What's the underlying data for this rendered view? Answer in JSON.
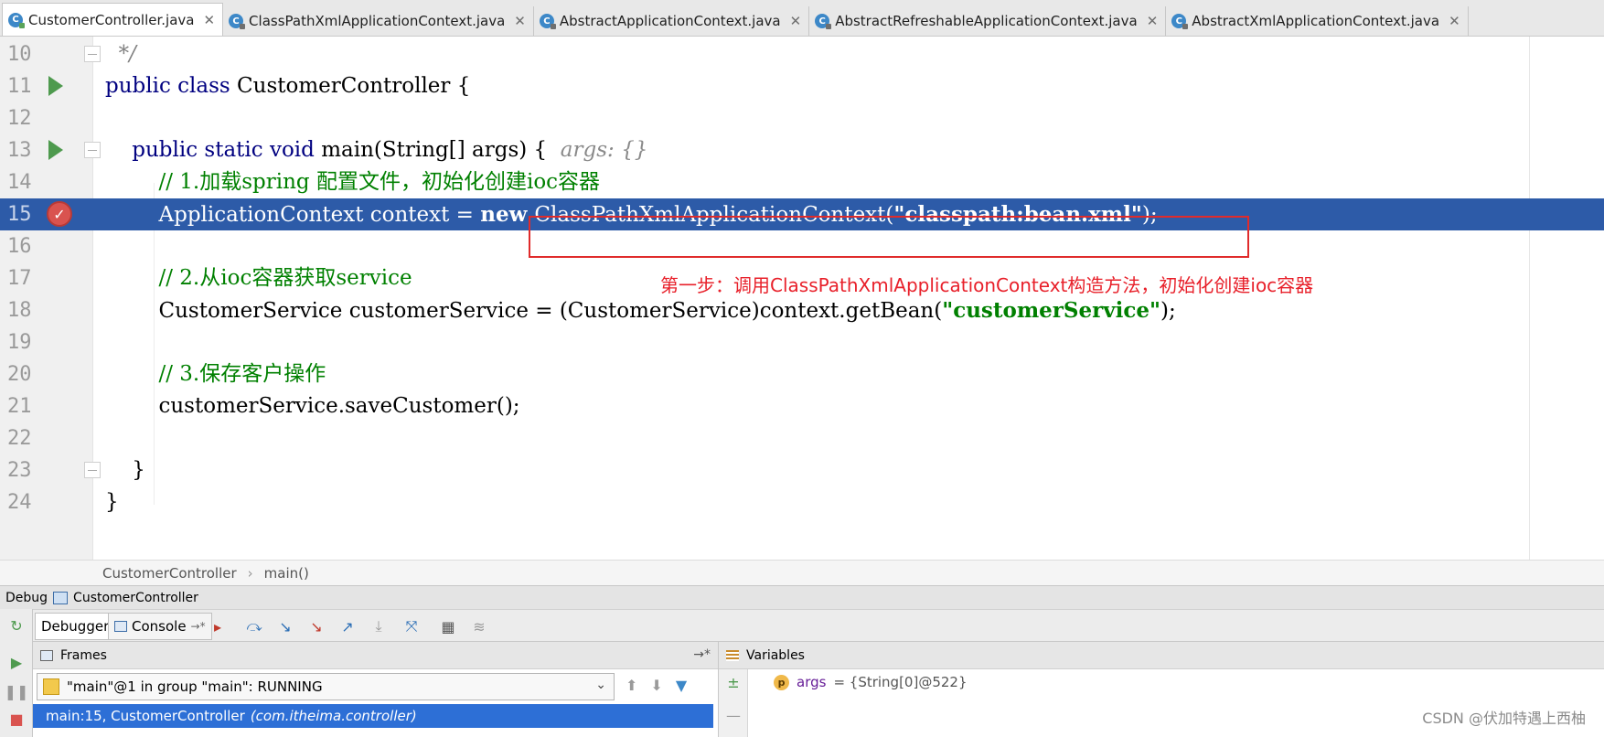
{
  "tabs": [
    {
      "label": "CustomerController.java",
      "active": true,
      "icon": "class-icon"
    },
    {
      "label": "ClassPathXmlApplicationContext.java",
      "active": false,
      "icon": "class-icon"
    },
    {
      "label": "AbstractApplicationContext.java",
      "active": false,
      "icon": "class-icon"
    },
    {
      "label": "AbstractRefreshableApplicationContext.java",
      "active": false,
      "icon": "class-icon"
    },
    {
      "label": "AbstractXmlApplicationContext.java",
      "active": false,
      "icon": "class-icon"
    }
  ],
  "editor": {
    "lines": [
      {
        "num": "10",
        "tokens": [
          [
            "cmt",
            "  */"
          ]
        ]
      },
      {
        "num": "11",
        "tokens": [
          [
            "kw",
            "public class "
          ],
          [
            "",
            "CustomerController {"
          ]
        ]
      },
      {
        "num": "12",
        "tokens": []
      },
      {
        "num": "13",
        "tokens": [
          [
            "",
            "    "
          ],
          [
            "kw",
            "public static void "
          ],
          [
            "",
            "main(String[] args) {  "
          ],
          [
            "hint",
            "args: {}"
          ]
        ]
      },
      {
        "num": "14",
        "tokens": [
          [
            "ccm",
            "        // 1.加载spring 配置文件，初始化创建ioc容器"
          ]
        ]
      },
      {
        "num": "15",
        "tokens": [
          [
            "",
            "        ApplicationContext context = "
          ],
          [
            "kw",
            "new "
          ],
          [
            "",
            "ClassPathXmlApplicationContext("
          ],
          [
            "str",
            "\"classpath:bean.xml\""
          ],
          [
            "",
            ");"
          ]
        ]
      },
      {
        "num": "16",
        "tokens": []
      },
      {
        "num": "17",
        "tokens": [
          [
            "ccm",
            "        // 2.从ioc容器获取service"
          ]
        ]
      },
      {
        "num": "18",
        "tokens": [
          [
            "",
            "        CustomerService customerService = (CustomerService)context.getBean("
          ],
          [
            "str",
            "\"customerService\""
          ],
          [
            "",
            ");"
          ]
        ]
      },
      {
        "num": "19",
        "tokens": []
      },
      {
        "num": "20",
        "tokens": [
          [
            "ccm",
            "        // 3.保存客户操作"
          ]
        ]
      },
      {
        "num": "21",
        "tokens": [
          [
            "",
            "        customerService.saveCustomer();"
          ]
        ]
      },
      {
        "num": "22",
        "tokens": []
      },
      {
        "num": "23",
        "tokens": [
          [
            "",
            "    }"
          ]
        ]
      },
      {
        "num": "24",
        "tokens": [
          [
            "",
            "}"
          ]
        ]
      }
    ],
    "exec_line": "15",
    "annotation": "第一步：调用ClassPathXmlApplicationContext构造方法，初始化创建ioc容器"
  },
  "breadcrumb": {
    "items": [
      "CustomerController",
      "main()"
    ]
  },
  "debug": {
    "label": "Debug",
    "config": "CustomerController",
    "tabs": {
      "debugger": "Debugger",
      "console": "Console"
    },
    "frames": {
      "title": "Frames",
      "thread": "\"main\"@1 in group \"main\": RUNNING",
      "frame_method": "main:15, CustomerController",
      "frame_pkg": "(com.itheima.controller)"
    },
    "variables": {
      "title": "Variables",
      "items": [
        {
          "name": "args",
          "value": "= {String[0]@522}"
        }
      ]
    }
  },
  "watermark": "CSDN @伏加特遇上西柚",
  "colors": {
    "exec_line": "#2d5ba8",
    "annotation": "#e8202a",
    "frame_selected": "#2d6fd6"
  }
}
